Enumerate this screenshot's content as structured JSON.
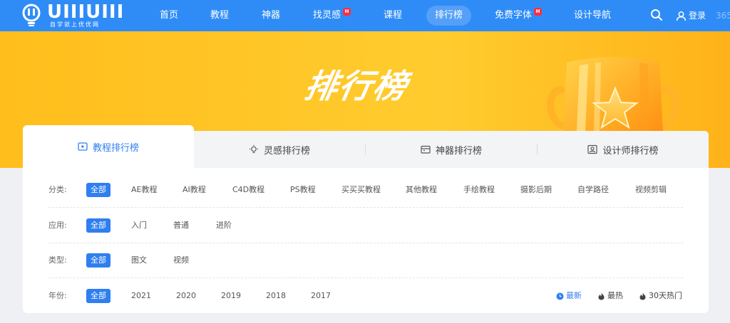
{
  "brand": {
    "logo_text": "UIIIUIII",
    "logo_sub": "自学就上优优网"
  },
  "nav": {
    "items": [
      {
        "label": "首页"
      },
      {
        "label": "教程"
      },
      {
        "label": "神器"
      },
      {
        "label": "找灵感",
        "badge": "H"
      },
      {
        "label": "课程"
      },
      {
        "label": "排行榜",
        "active": true
      },
      {
        "label": "免费字体",
        "badge": "H"
      },
      {
        "label": "设计导航"
      }
    ],
    "login_label": "登录",
    "edge_text": "365"
  },
  "banner": {
    "title": "排行榜"
  },
  "tabs": [
    {
      "label": "教程排行榜",
      "icon": "play-icon",
      "active": true
    },
    {
      "label": "灵感排行榜",
      "icon": "bulb-icon"
    },
    {
      "label": "神器排行榜",
      "icon": "toolbox-icon"
    },
    {
      "label": "设计师排行榜",
      "icon": "user-card-icon"
    }
  ],
  "filters": {
    "category": {
      "label": "分类:",
      "options": [
        "全部",
        "AE教程",
        "AI教程",
        "C4D教程",
        "PS教程",
        "买买买教程",
        "其他教程",
        "手绘教程",
        "摄影后期",
        "自学路径",
        "视频剪辑"
      ]
    },
    "application": {
      "label": "应用:",
      "options": [
        "全部",
        "入门",
        "普通",
        "进阶"
      ]
    },
    "type": {
      "label": "类型:",
      "options": [
        "全部",
        "图文",
        "视频"
      ]
    },
    "year": {
      "label": "年份:",
      "options": [
        "全部",
        "2021",
        "2020",
        "2019",
        "2018",
        "2017"
      ]
    }
  },
  "sort": [
    {
      "label": "最新",
      "icon": "clock-icon",
      "active": true
    },
    {
      "label": "最热",
      "icon": "flame-icon"
    },
    {
      "label": "30天热门",
      "icon": "flame-icon"
    }
  ],
  "colors": {
    "nav": "#2f8cf7",
    "accent": "#2f7ff0",
    "banner": "#ffc82a",
    "hot_badge": "#ff2d3f"
  }
}
